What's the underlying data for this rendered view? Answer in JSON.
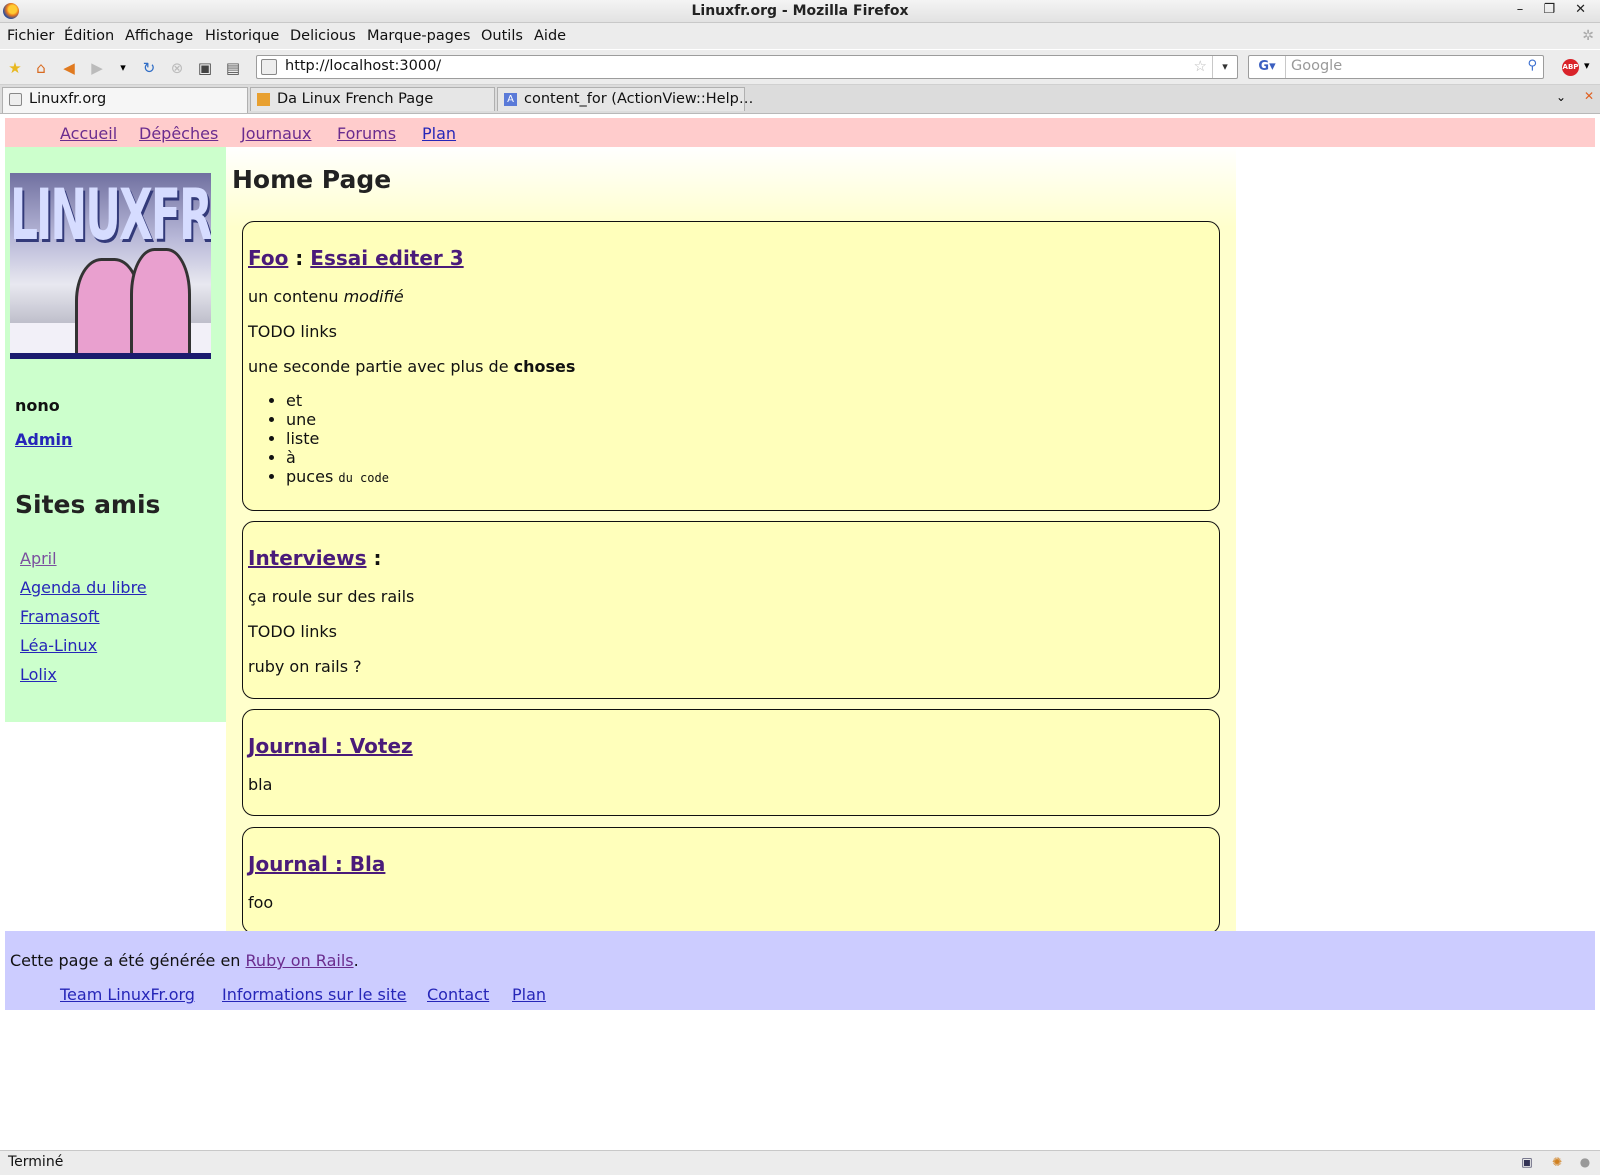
{
  "window": {
    "title": "Linuxfr.org - Mozilla Firefox",
    "controls": "– ❐ ✕"
  },
  "menu": [
    "Fichier",
    "Édition",
    "Affichage",
    "Historique",
    "Delicious",
    "Marque-pages",
    "Outils",
    "Aide"
  ],
  "toolbar": {
    "url": "http://localhost:3000/",
    "search_placeholder": "Google",
    "search_engine": "G"
  },
  "tabs": [
    {
      "label": "Linuxfr.org",
      "active": true
    },
    {
      "label": "Da Linux French Page",
      "active": false
    },
    {
      "label": "content_for (ActionView::Help…",
      "active": false
    }
  ],
  "topnav": [
    "Accueil",
    "Dépêches",
    "Journaux",
    "Forums",
    "Plan"
  ],
  "sidebar": {
    "logo_text": "LINUXFR.ORG",
    "user": "nono",
    "admin": "Admin",
    "sites_title": "Sites amis",
    "sites": [
      "April",
      "Agenda du libre",
      "Framasoft",
      "Léa-Linux",
      "Lolix"
    ]
  },
  "main": {
    "title": "Home Page",
    "items": [
      {
        "section": "Foo",
        "sep": " : ",
        "link": "Essai editer 3",
        "p1_pre": "un contenu ",
        "p1_em": "modifié",
        "p2": "TODO links",
        "p3_pre": "une seconde partie avec plus de ",
        "p3_strong": "choses",
        "list": [
          "et",
          "une",
          "liste",
          "à",
          "puces"
        ],
        "list_code": "du code"
      },
      {
        "section": "Interviews",
        "sep": " :",
        "p1": "ça roule sur des rails",
        "p2": "TODO links",
        "p3": "ruby on rails ?"
      },
      {
        "link": "Journal : Votez",
        "p1": "bla"
      },
      {
        "link": "Journal : Bla",
        "p1": "foo"
      }
    ]
  },
  "footer": {
    "gen_pre": "Cette page a été générée en ",
    "gen_link": "Ruby on Rails",
    "gen_post": ".",
    "links": [
      "Team LinuxFr.org",
      "Informations sur le site",
      "Contact",
      "Plan"
    ]
  },
  "status": {
    "text": "Terminé"
  }
}
